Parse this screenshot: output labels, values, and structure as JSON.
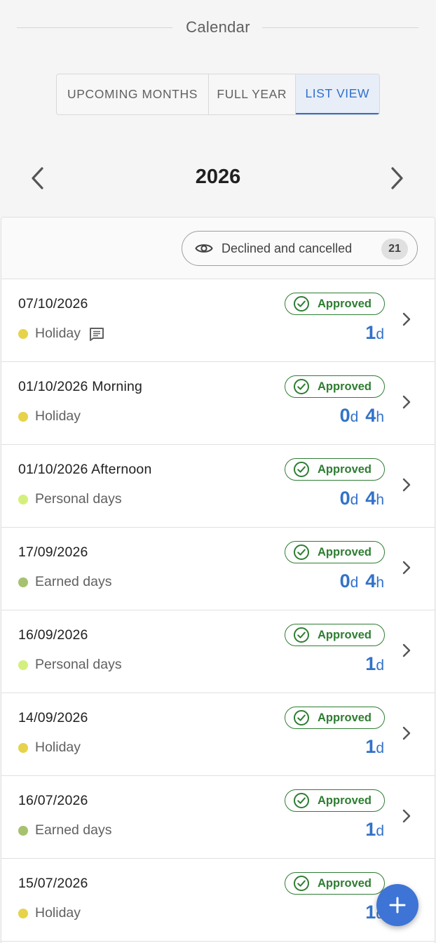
{
  "header": {
    "title": "Calendar"
  },
  "tabs": [
    {
      "label": "UPCOMING MONTHS",
      "active": false
    },
    {
      "label": "FULL YEAR",
      "active": false
    },
    {
      "label": "LIST VIEW",
      "active": true
    }
  ],
  "year_nav": {
    "year": "2026",
    "prev_icon": "chevron-left-icon",
    "next_icon": "chevron-right-icon"
  },
  "filter": {
    "label": "Declined and cancelled",
    "count": "21",
    "icon": "eye-icon"
  },
  "colors": {
    "accent": "#2f6fcc",
    "approved": "#2e7d32",
    "holiday": "#e6d34a",
    "personal_days": "#d4f07c",
    "earned_days": "#a6c26f"
  },
  "entries": [
    {
      "date": "07/10/2026",
      "type": "Holiday",
      "dot_color": "#e6d34a",
      "comment": true,
      "status": "Approved",
      "days": "1",
      "hours": ""
    },
    {
      "date": "01/10/2026 Morning",
      "type": "Holiday",
      "dot_color": "#e6d34a",
      "comment": false,
      "status": "Approved",
      "days": "0",
      "hours": "4"
    },
    {
      "date": "01/10/2026 Afternoon",
      "type": "Personal days",
      "dot_color": "#d4f07c",
      "comment": false,
      "status": "Approved",
      "days": "0",
      "hours": "4"
    },
    {
      "date": "17/09/2026",
      "type": "Earned days",
      "dot_color": "#a6c26f",
      "comment": false,
      "status": "Approved",
      "days": "0",
      "hours": "4"
    },
    {
      "date": "16/09/2026",
      "type": "Personal days",
      "dot_color": "#d4f07c",
      "comment": false,
      "status": "Approved",
      "days": "1",
      "hours": ""
    },
    {
      "date": "14/09/2026",
      "type": "Holiday",
      "dot_color": "#e6d34a",
      "comment": false,
      "status": "Approved",
      "days": "1",
      "hours": ""
    },
    {
      "date": "16/07/2026",
      "type": "Earned days",
      "dot_color": "#a6c26f",
      "comment": false,
      "status": "Approved",
      "days": "1",
      "hours": ""
    },
    {
      "date": "15/07/2026",
      "type": "Holiday",
      "dot_color": "#e6d34a",
      "comment": false,
      "status": "Approved",
      "days": "1",
      "hours": ""
    }
  ],
  "units": {
    "day": "d",
    "hour": "h"
  },
  "fab": {
    "icon": "plus-icon"
  }
}
